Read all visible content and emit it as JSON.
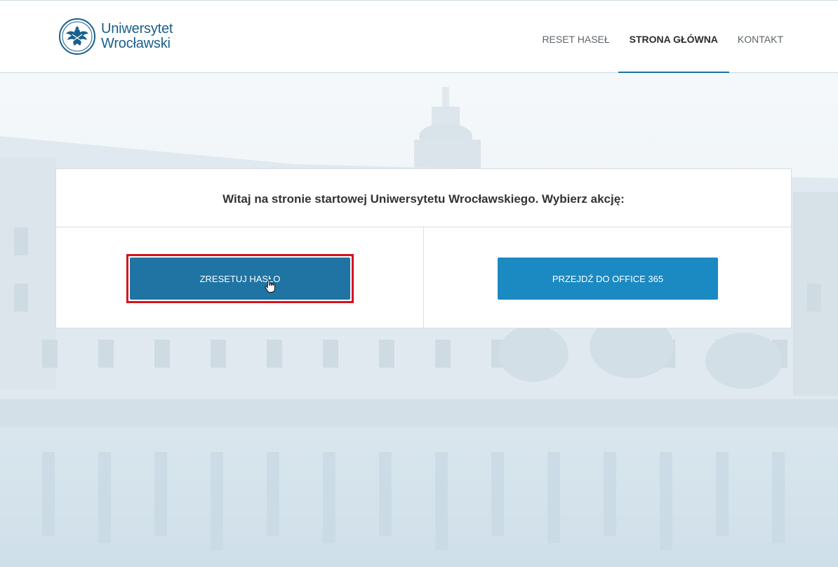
{
  "header": {
    "logo_line1": "Uniwersytet",
    "logo_line2": "Wrocławski",
    "nav": [
      {
        "label": "RESET HASEŁ",
        "active": false
      },
      {
        "label": "STRONA GŁÓWNA",
        "active": true
      },
      {
        "label": "KONTAKT",
        "active": false
      }
    ]
  },
  "main": {
    "welcome_text": "Witaj na stronie startowej Uniwersytetu Wrocławskiego. Wybierz akcję:",
    "reset_button_label": "ZRESETUJ HASŁO",
    "office_button_label": "PRZEJDŹ DO OFFICE 365"
  },
  "icons": {
    "logo": "university-eagle-emblem-icon",
    "cursor": "hand-pointer-icon"
  },
  "colors": {
    "brand": "#1a5f8b",
    "nav_active_underline": "#1e72a3",
    "reset_button": "#1f74a3",
    "office_button": "#1b89c2",
    "highlight_box": "#d5121f",
    "background_tint": "#eef4f7"
  }
}
